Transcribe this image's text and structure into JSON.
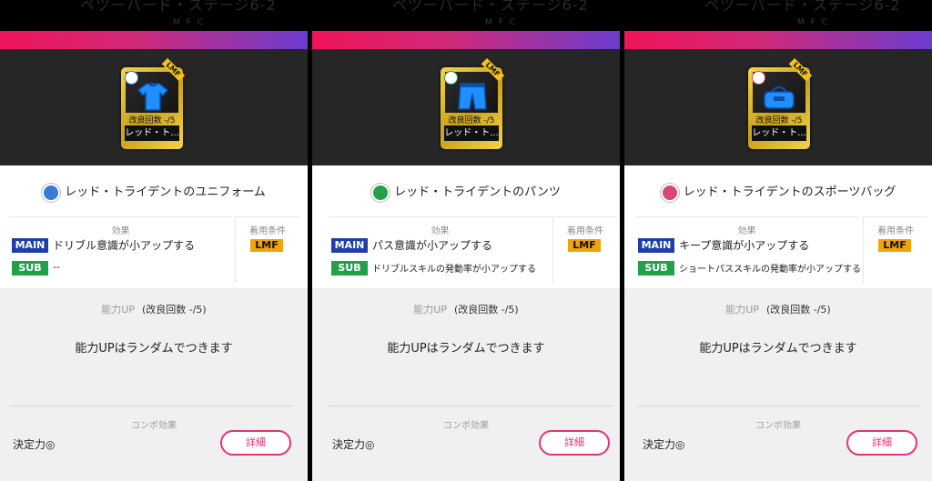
{
  "panels": [
    {
      "header_ghost": "ペツーバード・ステージ6-2",
      "header_ghost2": "M F C",
      "card": {
        "position": "LMF",
        "count_label": "改良回数 -/5",
        "name_short": "レッド・ト...",
        "item_icon": "shirt-icon",
        "item_color": "#1f8fff"
      },
      "title": "レッド・トライデントのユニフォーム",
      "category_icon": "shirt-category-icon",
      "effects_label": "効果",
      "main_tag": "MAIN",
      "main_text": "ドリブル意識が小アップする",
      "sub_tag": "SUB",
      "sub_text": "--",
      "cond_label": "着用条件",
      "cond_value": "LMF",
      "ability_label": "能力UP",
      "ability_count": "(改良回数 -/5)",
      "ability_text": "能力UPはランダムでつきます",
      "combo_label": "コンボ効果",
      "combo_text": "決定力◎",
      "detail_label": "詳細"
    },
    {
      "header_ghost": "ペツーバード・ステージ6-2",
      "header_ghost2": "M F C",
      "card": {
        "position": "LMF",
        "count_label": "改良回数 -/5",
        "name_short": "レッド・ト...",
        "item_icon": "shorts-icon",
        "item_color": "#1f8fff"
      },
      "title": "レッド・トライデントのパンツ",
      "category_icon": "shorts-category-icon",
      "effects_label": "効果",
      "main_tag": "MAIN",
      "main_text": "パス意識が小アップする",
      "sub_tag": "SUB",
      "sub_text": "ドリブルスキルの発動率が小アップする",
      "cond_label": "着用条件",
      "cond_value": "LMF",
      "ability_label": "能力UP",
      "ability_count": "(改良回数 -/5)",
      "ability_text": "能力UPはランダムでつきます",
      "combo_label": "コンボ効果",
      "combo_text": "決定力◎",
      "detail_label": "詳細"
    },
    {
      "header_ghost": "ペツーバード・ステージ6-2",
      "header_ghost2": "M F C",
      "card": {
        "position": "LMF",
        "count_label": "改良回数 -/5",
        "name_short": "レッド・ト...",
        "item_icon": "sports-bag-icon",
        "item_color": "#1f8fff"
      },
      "title": "レッド・トライデントのスポーツバッグ",
      "category_icon": "bag-category-icon",
      "effects_label": "効果",
      "main_tag": "MAIN",
      "main_text": "キープ意識が小アップする",
      "sub_tag": "SUB",
      "sub_text": "ショートパススキルの発動率が小アップする",
      "cond_label": "着用条件",
      "cond_value": "LMF",
      "ability_label": "能力UP",
      "ability_count": "(改良回数 -/5)",
      "ability_text": "能力UPはランダムでつきます",
      "combo_label": "コンボ効果",
      "combo_text": "決定力◎",
      "detail_label": "詳細"
    }
  ],
  "colors": {
    "gradient_start": "#f0145a",
    "gradient_end": "#6b3ccf",
    "main_tag": "#1e3fa8",
    "sub_tag": "#22a04a",
    "cond_tag": "#f2a20a",
    "detail_btn": "#e8307c",
    "category_shirt": "#3a7bd5",
    "category_shorts": "#22a04a",
    "category_bag": "#d9477a"
  }
}
